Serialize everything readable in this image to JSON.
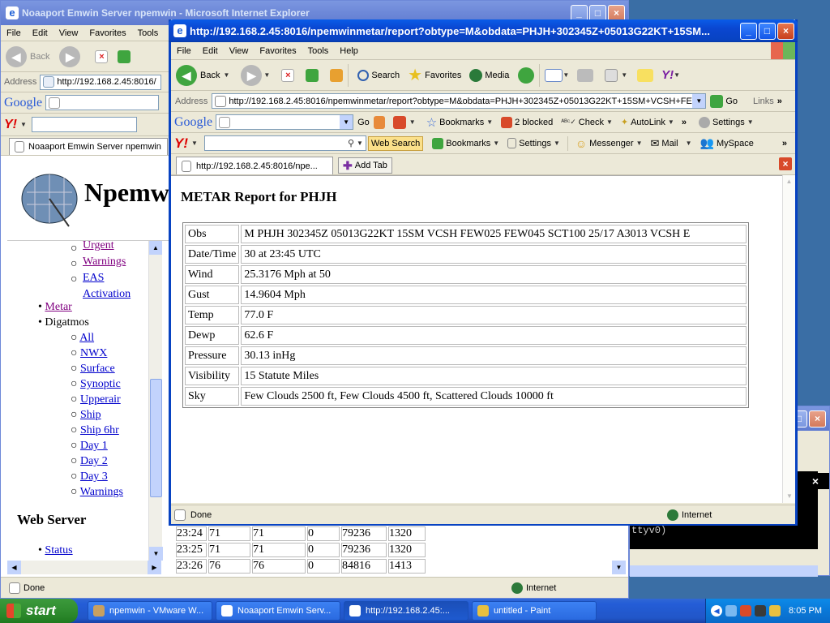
{
  "back_window": {
    "title": "Noaaport Emwin Server npemwin - Microsoft Internet Explorer",
    "menu": [
      "File",
      "Edit",
      "View",
      "Favorites",
      "Tools"
    ],
    "back_label": "Back",
    "address_label": "Address",
    "address_value": "http://192.168.2.45:8016/",
    "google_label": "Google",
    "tab_label": "Noaaport Emwin Server npemwin",
    "site_title": "Npemw",
    "nav": {
      "sub_top": [
        "Urgent",
        "Warnings",
        "EAS",
        "Activation"
      ],
      "metar": "Metar",
      "digatmos": "Digatmos",
      "digatmos_items": [
        "All",
        "NWX",
        "Surface",
        "Synoptic",
        "Upperair",
        "Ship",
        "Ship 6hr",
        "Day 1",
        "Day 2",
        "Day 3",
        "Warnings"
      ],
      "web_server_heading": "Web Server",
      "status": "Status"
    },
    "table_rows": [
      [
        "23:24",
        "71",
        "71",
        "0",
        "79236",
        "1320"
      ],
      [
        "23:25",
        "71",
        "71",
        "0",
        "79236",
        "1320"
      ],
      [
        "23:26",
        "76",
        "76",
        "0",
        "84816",
        "1413"
      ]
    ],
    "status_text": "Done",
    "zone_text": "Internet"
  },
  "front_window": {
    "title": "http://192.168.2.45:8016/npemwinmetar/report?obtype=M&obdata=PHJH+302345Z+05013G22KT+15SM...",
    "menu": [
      "File",
      "Edit",
      "View",
      "Favorites",
      "Tools",
      "Help"
    ],
    "toolbar": {
      "back": "Back",
      "search": "Search",
      "favorites": "Favorites",
      "media": "Media"
    },
    "address_label": "Address",
    "address_value": "http://192.168.2.45:8016/npemwinmetar/report?obtype=M&obdata=PHJH+302345Z+05013G22KT+15SM+VCSH+FEW025+FE",
    "go_label": "Go",
    "links_label": "Links",
    "google_bar": {
      "logo": "Google",
      "go": "Go",
      "bookmarks": "Bookmarks",
      "blocked": "2 blocked",
      "check": "Check",
      "autolink": "AutoLink",
      "settings": "Settings"
    },
    "yahoo_bar": {
      "web_search": "Web Search",
      "bookmarks": "Bookmarks",
      "settings": "Settings",
      "messenger": "Messenger",
      "mail": "Mail",
      "myspace": "MySpace"
    },
    "tab_label": "http://192.168.2.45:8016/npe...",
    "add_tab": "Add Tab",
    "page_heading": "METAR Report for PHJH",
    "report": [
      {
        "label": "Obs",
        "value": "M PHJH 302345Z 05013G22KT 15SM VCSH FEW025 FEW045 SCT100 25/17 A3013 VCSH E"
      },
      {
        "label": "Date/Time",
        "value": "30 at 23:45 UTC"
      },
      {
        "label": "Wind",
        "value": "25.3176 Mph at 50"
      },
      {
        "label": "Gust",
        "value": "14.9604 Mph"
      },
      {
        "label": "Temp",
        "value": "77.0 F"
      },
      {
        "label": "Dewp",
        "value": "62.6 F"
      },
      {
        "label": "Pressure",
        "value": "30.13 inHg"
      },
      {
        "label": "Visibility",
        "value": "15 Statute Miles"
      },
      {
        "label": "Sky",
        "value": "Few Clouds 2500 ft, Few Clouds 4500 ft, Scattered Clouds 10000 ft"
      }
    ],
    "status_text": "Done",
    "zone_text": "Internet"
  },
  "terminal": {
    "text": "ttyv0)"
  },
  "taskbar": {
    "start": "start",
    "items": [
      "npemwin - VMware W...",
      "Noaaport Emwin Serv...",
      "http://192.168.2.45:...",
      "untitled - Paint"
    ],
    "clock": "8:05 PM"
  }
}
